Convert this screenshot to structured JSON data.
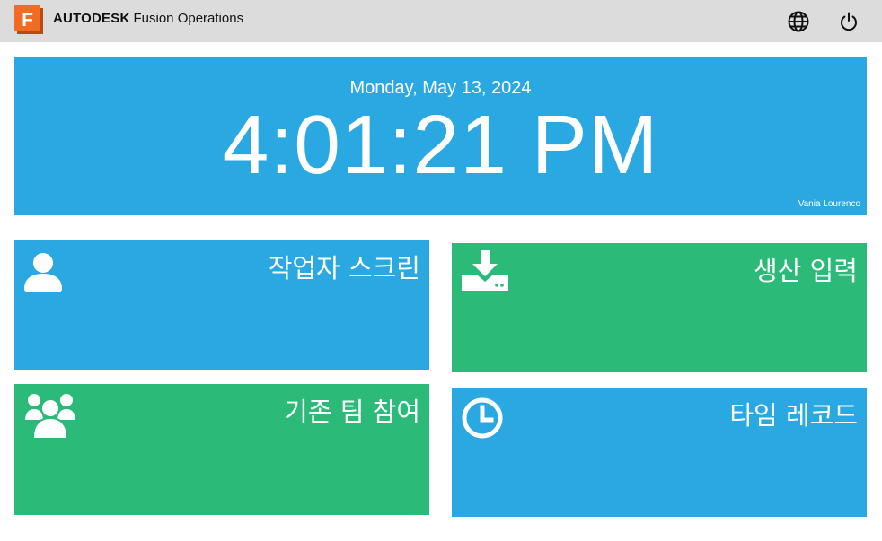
{
  "header": {
    "logo_letter": "F",
    "brand_bold": "AUTODESK",
    "brand_product": "Fusion Operations",
    "icons": [
      "globe-icon",
      "power-icon"
    ]
  },
  "clock": {
    "date": "Monday, May 13, 2024",
    "time": "4:01:21 PM",
    "user": "Vania Lourenco"
  },
  "tiles": [
    {
      "id": "operator-screen",
      "label": "작업자 스크린",
      "icon": "user-icon",
      "color": "#29a8e2"
    },
    {
      "id": "production-entry",
      "label": "생산 입력",
      "icon": "download-tray-icon",
      "color": "#2bba78"
    },
    {
      "id": "join-team",
      "label": "기존 팀 참여",
      "icon": "group-icon",
      "color": "#2bba78"
    },
    {
      "id": "time-record",
      "label": "타임 레코드",
      "icon": "clock-icon",
      "color": "#29a8e2"
    }
  ],
  "colors": {
    "topbar": "#dcdcdc",
    "accent_blue": "#29a8e2",
    "accent_green": "#2bba78",
    "logo_orange": "#f26b22"
  }
}
